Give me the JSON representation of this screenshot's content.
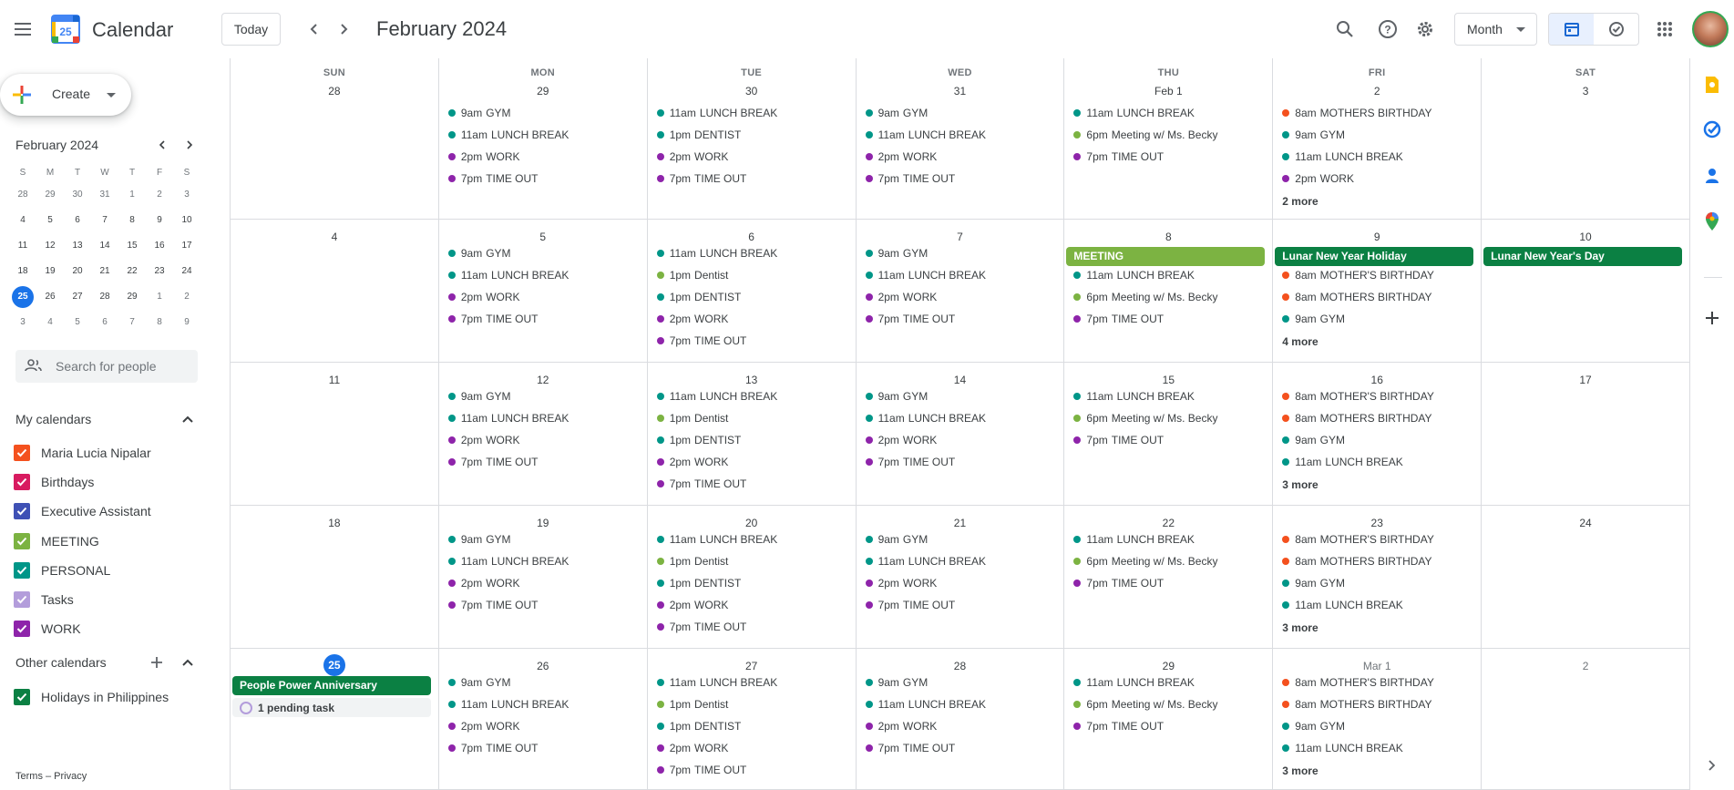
{
  "header": {
    "app_title": "Calendar",
    "logo_number": "25",
    "today_label": "Today",
    "current_period": "February 2024",
    "view_label": "Month"
  },
  "sidebar": {
    "create_label": "Create",
    "mini_title": "February 2024",
    "mini_dow": [
      "S",
      "M",
      "T",
      "W",
      "T",
      "F",
      "S"
    ],
    "mini_weeks": [
      [
        "28",
        "29",
        "30",
        "31",
        "1",
        "2",
        "3"
      ],
      [
        "4",
        "5",
        "6",
        "7",
        "8",
        "9",
        "10"
      ],
      [
        "11",
        "12",
        "13",
        "14",
        "15",
        "16",
        "17"
      ],
      [
        "18",
        "19",
        "20",
        "21",
        "22",
        "23",
        "24"
      ],
      [
        "25",
        "26",
        "27",
        "28",
        "29",
        "1",
        "2"
      ],
      [
        "3",
        "4",
        "5",
        "6",
        "7",
        "8",
        "9"
      ]
    ],
    "search_placeholder": "Search for people",
    "my_calendars_title": "My calendars",
    "my_calendars": [
      {
        "label": "Maria Lucia Nipalar",
        "color": "#f4511e"
      },
      {
        "label": "Birthdays",
        "color": "#d81b60"
      },
      {
        "label": "Executive Assistant",
        "color": "#3f51b5"
      },
      {
        "label": "MEETING",
        "color": "#7cb342"
      },
      {
        "label": "PERSONAL",
        "color": "#009688"
      },
      {
        "label": "Tasks",
        "color": "#b39ddb"
      },
      {
        "label": "WORK",
        "color": "#8e24aa"
      }
    ],
    "other_calendars_title": "Other calendars",
    "other_calendars": [
      {
        "label": "Holidays in Philippines",
        "color": "#0b8043"
      }
    ],
    "footer": "Terms – Privacy"
  },
  "colors": {
    "personal": "#009688",
    "work": "#8e24aa",
    "meeting": "#7cb342",
    "birthday": "#f4511e",
    "holiday": "#0b8043",
    "accent": "#1a73e8"
  },
  "calendar": {
    "dow": [
      "SUN",
      "MON",
      "TUE",
      "WED",
      "THU",
      "FRI",
      "SAT"
    ],
    "weeks": [
      {
        "days": [
          {
            "num": "28",
            "events": []
          },
          {
            "num": "29",
            "events": [
              {
                "time": "9am",
                "title": "GYM",
                "color": "#009688"
              },
              {
                "time": "11am",
                "title": "LUNCH BREAK",
                "color": "#009688"
              },
              {
                "time": "2pm",
                "title": "WORK",
                "color": "#8e24aa"
              },
              {
                "time": "7pm",
                "title": "TIME OUT",
                "color": "#8e24aa"
              }
            ]
          },
          {
            "num": "30",
            "events": [
              {
                "time": "11am",
                "title": "LUNCH BREAK",
                "color": "#009688"
              },
              {
                "time": "1pm",
                "title": "DENTIST",
                "color": "#009688"
              },
              {
                "time": "2pm",
                "title": "WORK",
                "color": "#8e24aa"
              },
              {
                "time": "7pm",
                "title": "TIME OUT",
                "color": "#8e24aa"
              }
            ]
          },
          {
            "num": "31",
            "events": [
              {
                "time": "9am",
                "title": "GYM",
                "color": "#009688"
              },
              {
                "time": "11am",
                "title": "LUNCH BREAK",
                "color": "#009688"
              },
              {
                "time": "2pm",
                "title": "WORK",
                "color": "#8e24aa"
              },
              {
                "time": "7pm",
                "title": "TIME OUT",
                "color": "#8e24aa"
              }
            ]
          },
          {
            "num": "Feb 1",
            "events": [
              {
                "time": "11am",
                "title": "LUNCH BREAK",
                "color": "#009688"
              },
              {
                "time": "6pm",
                "title": "Meeting w/ Ms. Becky",
                "color": "#7cb342"
              },
              {
                "time": "7pm",
                "title": "TIME OUT",
                "color": "#8e24aa"
              }
            ]
          },
          {
            "num": "2",
            "events": [
              {
                "time": "8am",
                "title": "MOTHERS BIRTHDAY",
                "color": "#f4511e"
              },
              {
                "time": "9am",
                "title": "GYM",
                "color": "#009688"
              },
              {
                "time": "11am",
                "title": "LUNCH BREAK",
                "color": "#009688"
              },
              {
                "time": "2pm",
                "title": "WORK",
                "color": "#8e24aa"
              }
            ],
            "more": "2 more"
          },
          {
            "num": "3",
            "events": []
          }
        ]
      },
      {
        "days": [
          {
            "num": "4",
            "events": []
          },
          {
            "num": "5",
            "events": [
              {
                "time": "9am",
                "title": "GYM",
                "color": "#009688"
              },
              {
                "time": "11am",
                "title": "LUNCH BREAK",
                "color": "#009688"
              },
              {
                "time": "2pm",
                "title": "WORK",
                "color": "#8e24aa"
              },
              {
                "time": "7pm",
                "title": "TIME OUT",
                "color": "#8e24aa"
              }
            ]
          },
          {
            "num": "6",
            "events": [
              {
                "time": "11am",
                "title": "LUNCH BREAK",
                "color": "#009688"
              },
              {
                "time": "1pm",
                "title": "Dentist",
                "color": "#7cb342"
              },
              {
                "time": "1pm",
                "title": "DENTIST",
                "color": "#009688"
              },
              {
                "time": "2pm",
                "title": "WORK",
                "color": "#8e24aa"
              },
              {
                "time": "7pm",
                "title": "TIME OUT",
                "color": "#8e24aa"
              }
            ]
          },
          {
            "num": "7",
            "events": [
              {
                "time": "9am",
                "title": "GYM",
                "color": "#009688"
              },
              {
                "time": "11am",
                "title": "LUNCH BREAK",
                "color": "#009688"
              },
              {
                "time": "2pm",
                "title": "WORK",
                "color": "#8e24aa"
              },
              {
                "time": "7pm",
                "title": "TIME OUT",
                "color": "#8e24aa"
              }
            ]
          },
          {
            "num": "8",
            "allday": {
              "title": "MEETING",
              "color": "#7cb342"
            },
            "events": [
              {
                "time": "11am",
                "title": "LUNCH BREAK",
                "color": "#009688"
              },
              {
                "time": "6pm",
                "title": "Meeting w/ Ms. Becky",
                "color": "#7cb342"
              },
              {
                "time": "7pm",
                "title": "TIME OUT",
                "color": "#8e24aa"
              }
            ]
          },
          {
            "num": "9",
            "allday": {
              "title": "Lunar New Year Holiday",
              "color": "#0b8043"
            },
            "events": [
              {
                "time": "8am",
                "title": "MOTHER'S BIRTHDAY",
                "color": "#f4511e"
              },
              {
                "time": "8am",
                "title": "MOTHERS BIRTHDAY",
                "color": "#f4511e"
              },
              {
                "time": "9am",
                "title": "GYM",
                "color": "#009688"
              }
            ],
            "more": "4 more"
          },
          {
            "num": "10",
            "allday": {
              "title": "Lunar New Year's Day",
              "color": "#0b8043"
            },
            "events": []
          }
        ]
      },
      {
        "days": [
          {
            "num": "11",
            "events": []
          },
          {
            "num": "12",
            "events": [
              {
                "time": "9am",
                "title": "GYM",
                "color": "#009688"
              },
              {
                "time": "11am",
                "title": "LUNCH BREAK",
                "color": "#009688"
              },
              {
                "time": "2pm",
                "title": "WORK",
                "color": "#8e24aa"
              },
              {
                "time": "7pm",
                "title": "TIME OUT",
                "color": "#8e24aa"
              }
            ]
          },
          {
            "num": "13",
            "events": [
              {
                "time": "11am",
                "title": "LUNCH BREAK",
                "color": "#009688"
              },
              {
                "time": "1pm",
                "title": "Dentist",
                "color": "#7cb342"
              },
              {
                "time": "1pm",
                "title": "DENTIST",
                "color": "#009688"
              },
              {
                "time": "2pm",
                "title": "WORK",
                "color": "#8e24aa"
              },
              {
                "time": "7pm",
                "title": "TIME OUT",
                "color": "#8e24aa"
              }
            ]
          },
          {
            "num": "14",
            "events": [
              {
                "time": "9am",
                "title": "GYM",
                "color": "#009688"
              },
              {
                "time": "11am",
                "title": "LUNCH BREAK",
                "color": "#009688"
              },
              {
                "time": "2pm",
                "title": "WORK",
                "color": "#8e24aa"
              },
              {
                "time": "7pm",
                "title": "TIME OUT",
                "color": "#8e24aa"
              }
            ]
          },
          {
            "num": "15",
            "events": [
              {
                "time": "11am",
                "title": "LUNCH BREAK",
                "color": "#009688"
              },
              {
                "time": "6pm",
                "title": "Meeting w/ Ms. Becky",
                "color": "#7cb342"
              },
              {
                "time": "7pm",
                "title": "TIME OUT",
                "color": "#8e24aa"
              }
            ]
          },
          {
            "num": "16",
            "events": [
              {
                "time": "8am",
                "title": "MOTHER'S BIRTHDAY",
                "color": "#f4511e"
              },
              {
                "time": "8am",
                "title": "MOTHERS BIRTHDAY",
                "color": "#f4511e"
              },
              {
                "time": "9am",
                "title": "GYM",
                "color": "#009688"
              },
              {
                "time": "11am",
                "title": "LUNCH BREAK",
                "color": "#009688"
              }
            ],
            "more": "3 more"
          },
          {
            "num": "17",
            "events": []
          }
        ]
      },
      {
        "days": [
          {
            "num": "18",
            "events": []
          },
          {
            "num": "19",
            "events": [
              {
                "time": "9am",
                "title": "GYM",
                "color": "#009688"
              },
              {
                "time": "11am",
                "title": "LUNCH BREAK",
                "color": "#009688"
              },
              {
                "time": "2pm",
                "title": "WORK",
                "color": "#8e24aa"
              },
              {
                "time": "7pm",
                "title": "TIME OUT",
                "color": "#8e24aa"
              }
            ]
          },
          {
            "num": "20",
            "events": [
              {
                "time": "11am",
                "title": "LUNCH BREAK",
                "color": "#009688"
              },
              {
                "time": "1pm",
                "title": "Dentist",
                "color": "#7cb342"
              },
              {
                "time": "1pm",
                "title": "DENTIST",
                "color": "#009688"
              },
              {
                "time": "2pm",
                "title": "WORK",
                "color": "#8e24aa"
              },
              {
                "time": "7pm",
                "title": "TIME OUT",
                "color": "#8e24aa"
              }
            ]
          },
          {
            "num": "21",
            "events": [
              {
                "time": "9am",
                "title": "GYM",
                "color": "#009688"
              },
              {
                "time": "11am",
                "title": "LUNCH BREAK",
                "color": "#009688"
              },
              {
                "time": "2pm",
                "title": "WORK",
                "color": "#8e24aa"
              },
              {
                "time": "7pm",
                "title": "TIME OUT",
                "color": "#8e24aa"
              }
            ]
          },
          {
            "num": "22",
            "events": [
              {
                "time": "11am",
                "title": "LUNCH BREAK",
                "color": "#009688"
              },
              {
                "time": "6pm",
                "title": "Meeting w/ Ms. Becky",
                "color": "#7cb342"
              },
              {
                "time": "7pm",
                "title": "TIME OUT",
                "color": "#8e24aa"
              }
            ]
          },
          {
            "num": "23",
            "events": [
              {
                "time": "8am",
                "title": "MOTHER'S BIRTHDAY",
                "color": "#f4511e"
              },
              {
                "time": "8am",
                "title": "MOTHERS BIRTHDAY",
                "color": "#f4511e"
              },
              {
                "time": "9am",
                "title": "GYM",
                "color": "#009688"
              },
              {
                "time": "11am",
                "title": "LUNCH BREAK",
                "color": "#009688"
              }
            ],
            "more": "3 more"
          },
          {
            "num": "24",
            "events": []
          }
        ]
      },
      {
        "days": [
          {
            "num": "25",
            "today": true,
            "allday": {
              "title": "People Power Anniversary",
              "color": "#0b8043"
            },
            "task": "1 pending task",
            "events": []
          },
          {
            "num": "26",
            "events": [
              {
                "time": "9am",
                "title": "GYM",
                "color": "#009688"
              },
              {
                "time": "11am",
                "title": "LUNCH BREAK",
                "color": "#009688"
              },
              {
                "time": "2pm",
                "title": "WORK",
                "color": "#8e24aa"
              },
              {
                "time": "7pm",
                "title": "TIME OUT",
                "color": "#8e24aa"
              }
            ]
          },
          {
            "num": "27",
            "events": [
              {
                "time": "11am",
                "title": "LUNCH BREAK",
                "color": "#009688"
              },
              {
                "time": "1pm",
                "title": "Dentist",
                "color": "#7cb342"
              },
              {
                "time": "1pm",
                "title": "DENTIST",
                "color": "#009688"
              },
              {
                "time": "2pm",
                "title": "WORK",
                "color": "#8e24aa"
              },
              {
                "time": "7pm",
                "title": "TIME OUT",
                "color": "#8e24aa"
              }
            ]
          },
          {
            "num": "28",
            "events": [
              {
                "time": "9am",
                "title": "GYM",
                "color": "#009688"
              },
              {
                "time": "11am",
                "title": "LUNCH BREAK",
                "color": "#009688"
              },
              {
                "time": "2pm",
                "title": "WORK",
                "color": "#8e24aa"
              },
              {
                "time": "7pm",
                "title": "TIME OUT",
                "color": "#8e24aa"
              }
            ]
          },
          {
            "num": "29",
            "events": [
              {
                "time": "11am",
                "title": "LUNCH BREAK",
                "color": "#009688"
              },
              {
                "time": "6pm",
                "title": "Meeting w/ Ms. Becky",
                "color": "#7cb342"
              },
              {
                "time": "7pm",
                "title": "TIME OUT",
                "color": "#8e24aa"
              }
            ]
          },
          {
            "num": "Mar 1",
            "other": true,
            "events": [
              {
                "time": "8am",
                "title": "MOTHER'S BIRTHDAY",
                "color": "#f4511e"
              },
              {
                "time": "8am",
                "title": "MOTHERS BIRTHDAY",
                "color": "#f4511e"
              },
              {
                "time": "9am",
                "title": "GYM",
                "color": "#009688"
              },
              {
                "time": "11am",
                "title": "LUNCH BREAK",
                "color": "#009688"
              }
            ],
            "more": "3 more"
          },
          {
            "num": "2",
            "other": true,
            "events": []
          }
        ]
      }
    ]
  }
}
